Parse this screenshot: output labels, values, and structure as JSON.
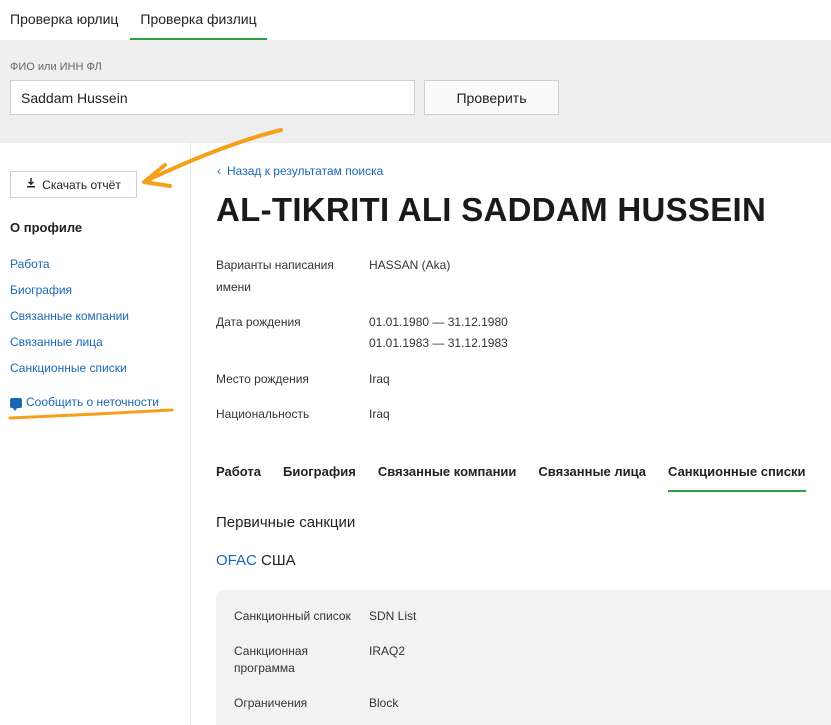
{
  "top_tabs": [
    {
      "label": "Проверка юрлиц",
      "active": false
    },
    {
      "label": "Проверка физлиц",
      "active": true
    }
  ],
  "search": {
    "label": "ФИО или ИНН ФЛ",
    "value": "Saddam Hussein",
    "button_label": "Проверить"
  },
  "sidebar": {
    "download_label": "Скачать отчёт",
    "download_icon": "download-icon",
    "profile_heading": "О профиле",
    "links": [
      "Работа",
      "Биография",
      "Связанные компании",
      "Связанные лица",
      "Санкционные списки"
    ],
    "report_label": "Сообщить о неточности",
    "report_icon": "comment-icon"
  },
  "main": {
    "back_label": "Назад к результатам поиска",
    "name": "AL-TIKRITI ALI SADDAM HUSSEIN",
    "info": {
      "variants_label_1": "Варианты написания",
      "variants_label_2": "имени",
      "variants_value": "HASSAN (Aka)",
      "birth_label": "Дата рождения",
      "birth_value_1": "01.01.1980 — 31.12.1980",
      "birth_value_2": "01.01.1983 — 31.12.1983",
      "birthplace_label": "Место рождения",
      "birthplace_value": "Iraq",
      "nationality_label": "Национальность",
      "nationality_value": "Iraq"
    },
    "section_tabs": [
      {
        "label": "Работа",
        "active": false
      },
      {
        "label": "Биография",
        "active": false
      },
      {
        "label": "Связанные компании",
        "active": false
      },
      {
        "label": "Связанные лица",
        "active": false
      },
      {
        "label": "Санкционные списки",
        "active": true
      }
    ],
    "primary_heading": "Первичные санкции",
    "ofac_link": "OFAC",
    "ofac_country": "США",
    "card": {
      "list_label": "Санкционный список",
      "list_value": "SDN List",
      "program_label_1": "Санкционная",
      "program_label_2": "программа",
      "program_value": "IRAQ2",
      "restrictions_label": "Ограничения",
      "restrictions_value": "Block"
    }
  },
  "colors": {
    "accent_green": "#2ea043",
    "link_blue": "#1a66b8",
    "annotation_orange": "#f5a01a"
  }
}
